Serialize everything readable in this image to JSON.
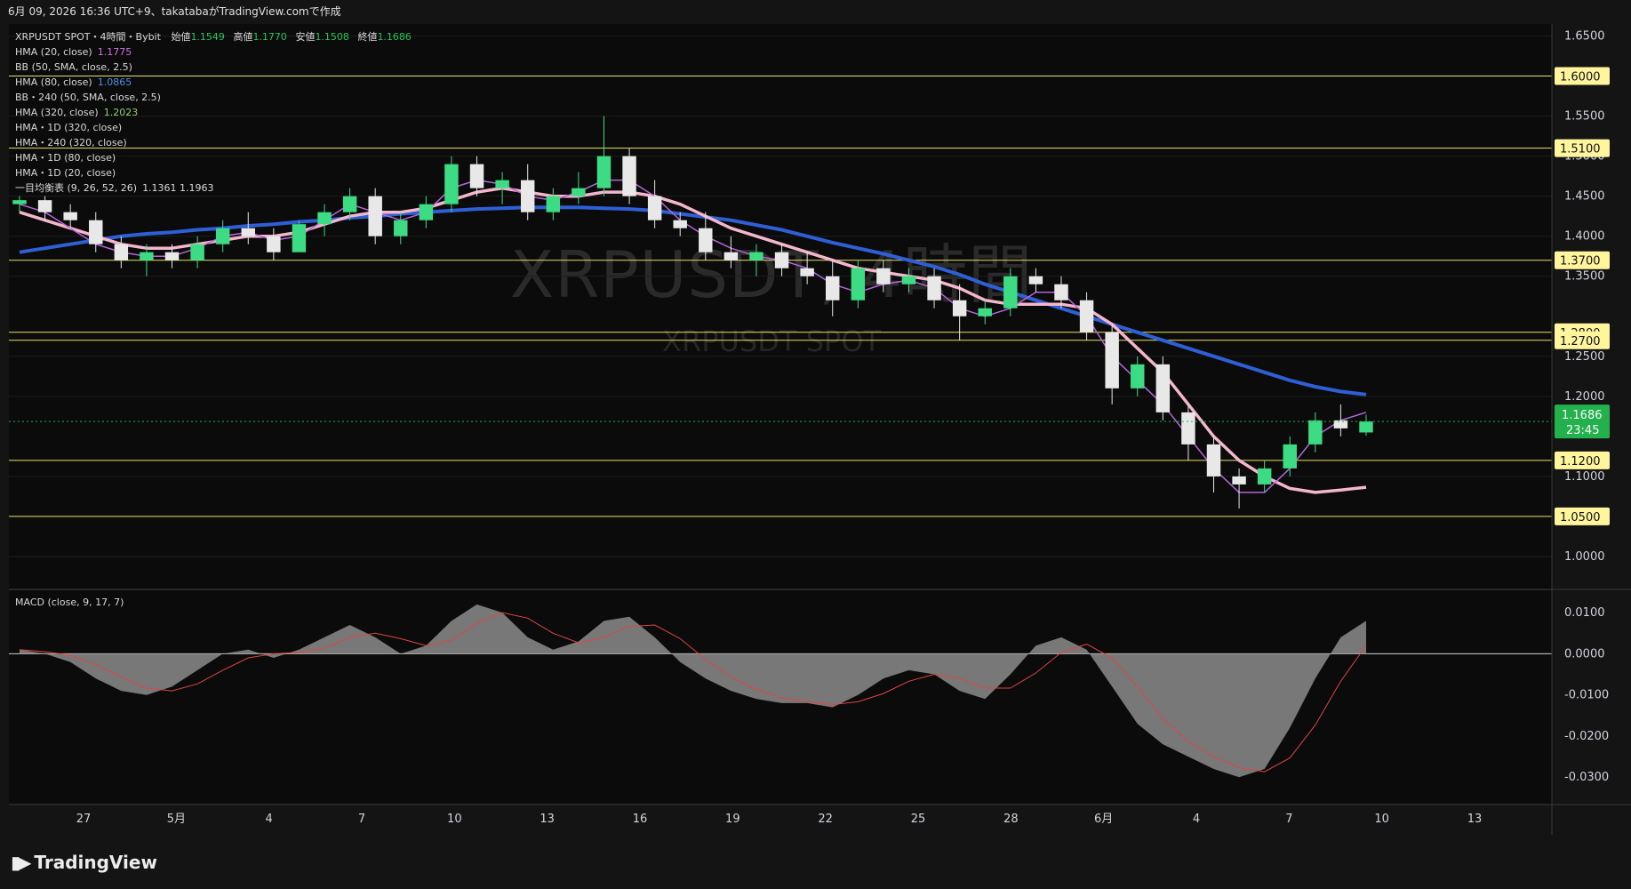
{
  "header": {
    "caption": "6月 09, 2026 16:36 UTC+9、takatabaがTradingView.comで作成"
  },
  "legend": {
    "symbol_line": {
      "symbol": "XRPUSDT SPOT・4時間・Bybit",
      "open_label": "始値",
      "open": "1.1549",
      "high_label": "高値",
      "high": "1.1770",
      "low_label": "安値",
      "low": "1.1508",
      "close_label": "終値",
      "close": "1.1686"
    },
    "indicators": [
      {
        "name": "HMA (20, close)",
        "value": "1.1775",
        "color": "#d070e8"
      },
      {
        "name": "BB (50, SMA, close, 2.5)",
        "value": "",
        "color": "#d8d8d8"
      },
      {
        "name": "HMA (80, close)",
        "value": "1.0865",
        "color": "#4f8fe8"
      },
      {
        "name": "BB・240 (50, SMA, close, 2.5)",
        "value": "",
        "color": "#d8d8d8"
      },
      {
        "name": "HMA (320, close)",
        "value": "1.2023",
        "color": "#8ecf6a"
      },
      {
        "name": "HMA・1D (320, close)",
        "value": "",
        "color": "#d8d8d8"
      },
      {
        "name": "HMA・240 (320, close)",
        "value": "",
        "color": "#d8d8d8"
      },
      {
        "name": "HMA・1D (80, close)",
        "value": "",
        "color": "#d8d8d8"
      },
      {
        "name": "HMA・1D (20, close)",
        "value": "",
        "color": "#d8d8d8"
      },
      {
        "name": "一目均衡表 (9, 26, 52, 26)",
        "value": "1.1361  1.1963",
        "color": "#d8d8d8"
      }
    ],
    "macd": "MACD (close, 9, 17, 7)"
  },
  "watermark": {
    "line1": "XRPUSDT, 4時間",
    "line2": "XRPUSDT SPOT"
  },
  "branding": {
    "name": "TradingView"
  },
  "chart_data": [
    {
      "type": "candlestick",
      "title": "XRPUSDT SPOT・4時間・Bybit",
      "ylim": [
        0.96,
        1.665
      ],
      "y_ticks": [
        "1.6500",
        "1.5500",
        "1.5000",
        "1.4500",
        "1.4000",
        "1.3500",
        "1.2500",
        "1.2000",
        "1.1000",
        "1.0000"
      ],
      "x_ticks": [
        "27",
        "5月",
        "4",
        "7",
        "10",
        "13",
        "16",
        "19",
        "22",
        "25",
        "28",
        "6月",
        "4",
        "7",
        "10",
        "13"
      ],
      "horizontal_levels": [
        {
          "label": "1.6000",
          "value": 1.6
        },
        {
          "label": "1.5100",
          "value": 1.51
        },
        {
          "label": "1.3700",
          "value": 1.37
        },
        {
          "label": "1.2800",
          "value": 1.28
        },
        {
          "label": "1.2700",
          "value": 1.27
        },
        {
          "label": "1.1200",
          "value": 1.12
        },
        {
          "label": "1.0500",
          "value": 1.05
        }
      ],
      "price_label": {
        "value": "1.1686",
        "countdown": "23:45",
        "color": "#22b14c"
      },
      "candles_ohlc": [
        [
          1.44,
          1.45,
          1.43,
          1.445
        ],
        [
          1.445,
          1.45,
          1.42,
          1.43
        ],
        [
          1.43,
          1.44,
          1.41,
          1.42
        ],
        [
          1.42,
          1.43,
          1.38,
          1.39
        ],
        [
          1.39,
          1.4,
          1.36,
          1.37
        ],
        [
          1.37,
          1.39,
          1.35,
          1.38
        ],
        [
          1.38,
          1.39,
          1.36,
          1.37
        ],
        [
          1.37,
          1.4,
          1.36,
          1.39
        ],
        [
          1.39,
          1.42,
          1.38,
          1.41
        ],
        [
          1.41,
          1.43,
          1.39,
          1.4
        ],
        [
          1.4,
          1.41,
          1.37,
          1.38
        ],
        [
          1.38,
          1.42,
          1.38,
          1.415
        ],
        [
          1.415,
          1.44,
          1.4,
          1.43
        ],
        [
          1.43,
          1.46,
          1.42,
          1.45
        ],
        [
          1.45,
          1.46,
          1.39,
          1.4
        ],
        [
          1.4,
          1.43,
          1.39,
          1.42
        ],
        [
          1.42,
          1.45,
          1.41,
          1.44
        ],
        [
          1.44,
          1.5,
          1.43,
          1.49
        ],
        [
          1.49,
          1.5,
          1.45,
          1.46
        ],
        [
          1.46,
          1.48,
          1.44,
          1.47
        ],
        [
          1.47,
          1.49,
          1.42,
          1.43
        ],
        [
          1.43,
          1.46,
          1.42,
          1.45
        ],
        [
          1.45,
          1.48,
          1.44,
          1.46
        ],
        [
          1.46,
          1.55,
          1.45,
          1.5
        ],
        [
          1.5,
          1.51,
          1.44,
          1.45
        ],
        [
          1.45,
          1.47,
          1.41,
          1.42
        ],
        [
          1.42,
          1.43,
          1.4,
          1.41
        ],
        [
          1.41,
          1.43,
          1.37,
          1.38
        ],
        [
          1.38,
          1.4,
          1.36,
          1.37
        ],
        [
          1.37,
          1.39,
          1.35,
          1.38
        ],
        [
          1.38,
          1.39,
          1.35,
          1.36
        ],
        [
          1.36,
          1.38,
          1.34,
          1.35
        ],
        [
          1.35,
          1.37,
          1.3,
          1.32
        ],
        [
          1.32,
          1.37,
          1.31,
          1.36
        ],
        [
          1.36,
          1.37,
          1.33,
          1.34
        ],
        [
          1.34,
          1.36,
          1.33,
          1.35
        ],
        [
          1.35,
          1.36,
          1.31,
          1.32
        ],
        [
          1.32,
          1.34,
          1.27,
          1.3
        ],
        [
          1.3,
          1.32,
          1.29,
          1.31
        ],
        [
          1.31,
          1.36,
          1.3,
          1.35
        ],
        [
          1.35,
          1.36,
          1.33,
          1.34
        ],
        [
          1.34,
          1.35,
          1.31,
          1.32
        ],
        [
          1.32,
          1.33,
          1.27,
          1.28
        ],
        [
          1.28,
          1.29,
          1.19,
          1.21
        ],
        [
          1.21,
          1.25,
          1.2,
          1.24
        ],
        [
          1.24,
          1.25,
          1.17,
          1.18
        ],
        [
          1.18,
          1.19,
          1.12,
          1.14
        ],
        [
          1.14,
          1.15,
          1.08,
          1.1
        ],
        [
          1.1,
          1.11,
          1.06,
          1.09
        ],
        [
          1.09,
          1.12,
          1.08,
          1.11
        ],
        [
          1.11,
          1.15,
          1.1,
          1.14
        ],
        [
          1.14,
          1.18,
          1.13,
          1.17
        ],
        [
          1.17,
          1.19,
          1.15,
          1.16
        ],
        [
          1.1549,
          1.177,
          1.1508,
          1.1686
        ]
      ],
      "hma_20": [
        1.44,
        1.43,
        1.41,
        1.39,
        1.38,
        1.375,
        1.375,
        1.385,
        1.4,
        1.405,
        1.395,
        1.4,
        1.42,
        1.44,
        1.43,
        1.42,
        1.43,
        1.46,
        1.47,
        1.465,
        1.45,
        1.445,
        1.455,
        1.47,
        1.47,
        1.45,
        1.42,
        1.4,
        1.385,
        1.375,
        1.37,
        1.36,
        1.34,
        1.33,
        1.34,
        1.345,
        1.335,
        1.31,
        1.3,
        1.31,
        1.33,
        1.33,
        1.3,
        1.25,
        1.22,
        1.19,
        1.15,
        1.11,
        1.08,
        1.08,
        1.11,
        1.15,
        1.17,
        1.18
      ],
      "hma_80": [
        1.43,
        1.42,
        1.41,
        1.4,
        1.39,
        1.385,
        1.385,
        1.39,
        1.395,
        1.4,
        1.4,
        1.405,
        1.415,
        1.425,
        1.43,
        1.43,
        1.435,
        1.445,
        1.455,
        1.46,
        1.455,
        1.45,
        1.45,
        1.455,
        1.455,
        1.45,
        1.44,
        1.425,
        1.41,
        1.4,
        1.39,
        1.38,
        1.37,
        1.36,
        1.355,
        1.35,
        1.345,
        1.335,
        1.32,
        1.315,
        1.315,
        1.315,
        1.31,
        1.29,
        1.26,
        1.23,
        1.19,
        1.15,
        1.12,
        1.1,
        1.085,
        1.08,
        1.083,
        1.0865
      ],
      "hma_320": [
        1.38,
        1.385,
        1.39,
        1.395,
        1.4,
        1.403,
        1.405,
        1.408,
        1.41,
        1.413,
        1.415,
        1.418,
        1.42,
        1.423,
        1.425,
        1.428,
        1.43,
        1.432,
        1.434,
        1.435,
        1.436,
        1.436,
        1.436,
        1.435,
        1.434,
        1.432,
        1.428,
        1.424,
        1.42,
        1.414,
        1.408,
        1.4,
        1.392,
        1.385,
        1.378,
        1.37,
        1.362,
        1.352,
        1.34,
        1.33,
        1.32,
        1.31,
        1.3,
        1.29,
        1.28,
        1.27,
        1.26,
        1.25,
        1.24,
        1.23,
        1.22,
        1.212,
        1.206,
        1.2023
      ],
      "macd_line": [
        0.001,
        0.0,
        -0.002,
        -0.006,
        -0.009,
        -0.01,
        -0.008,
        -0.004,
        0.0,
        0.001,
        -0.001,
        0.001,
        0.004,
        0.007,
        0.004,
        0.0,
        0.002,
        0.008,
        0.012,
        0.01,
        0.004,
        0.001,
        0.003,
        0.008,
        0.009,
        0.004,
        -0.002,
        -0.006,
        -0.009,
        -0.011,
        -0.012,
        -0.012,
        -0.013,
        -0.01,
        -0.006,
        -0.004,
        -0.005,
        -0.009,
        -0.011,
        -0.005,
        0.002,
        0.004,
        0.001,
        -0.008,
        -0.017,
        -0.022,
        -0.025,
        -0.028,
        -0.03,
        -0.028,
        -0.018,
        -0.006,
        0.004,
        0.008
      ]
    }
  ]
}
